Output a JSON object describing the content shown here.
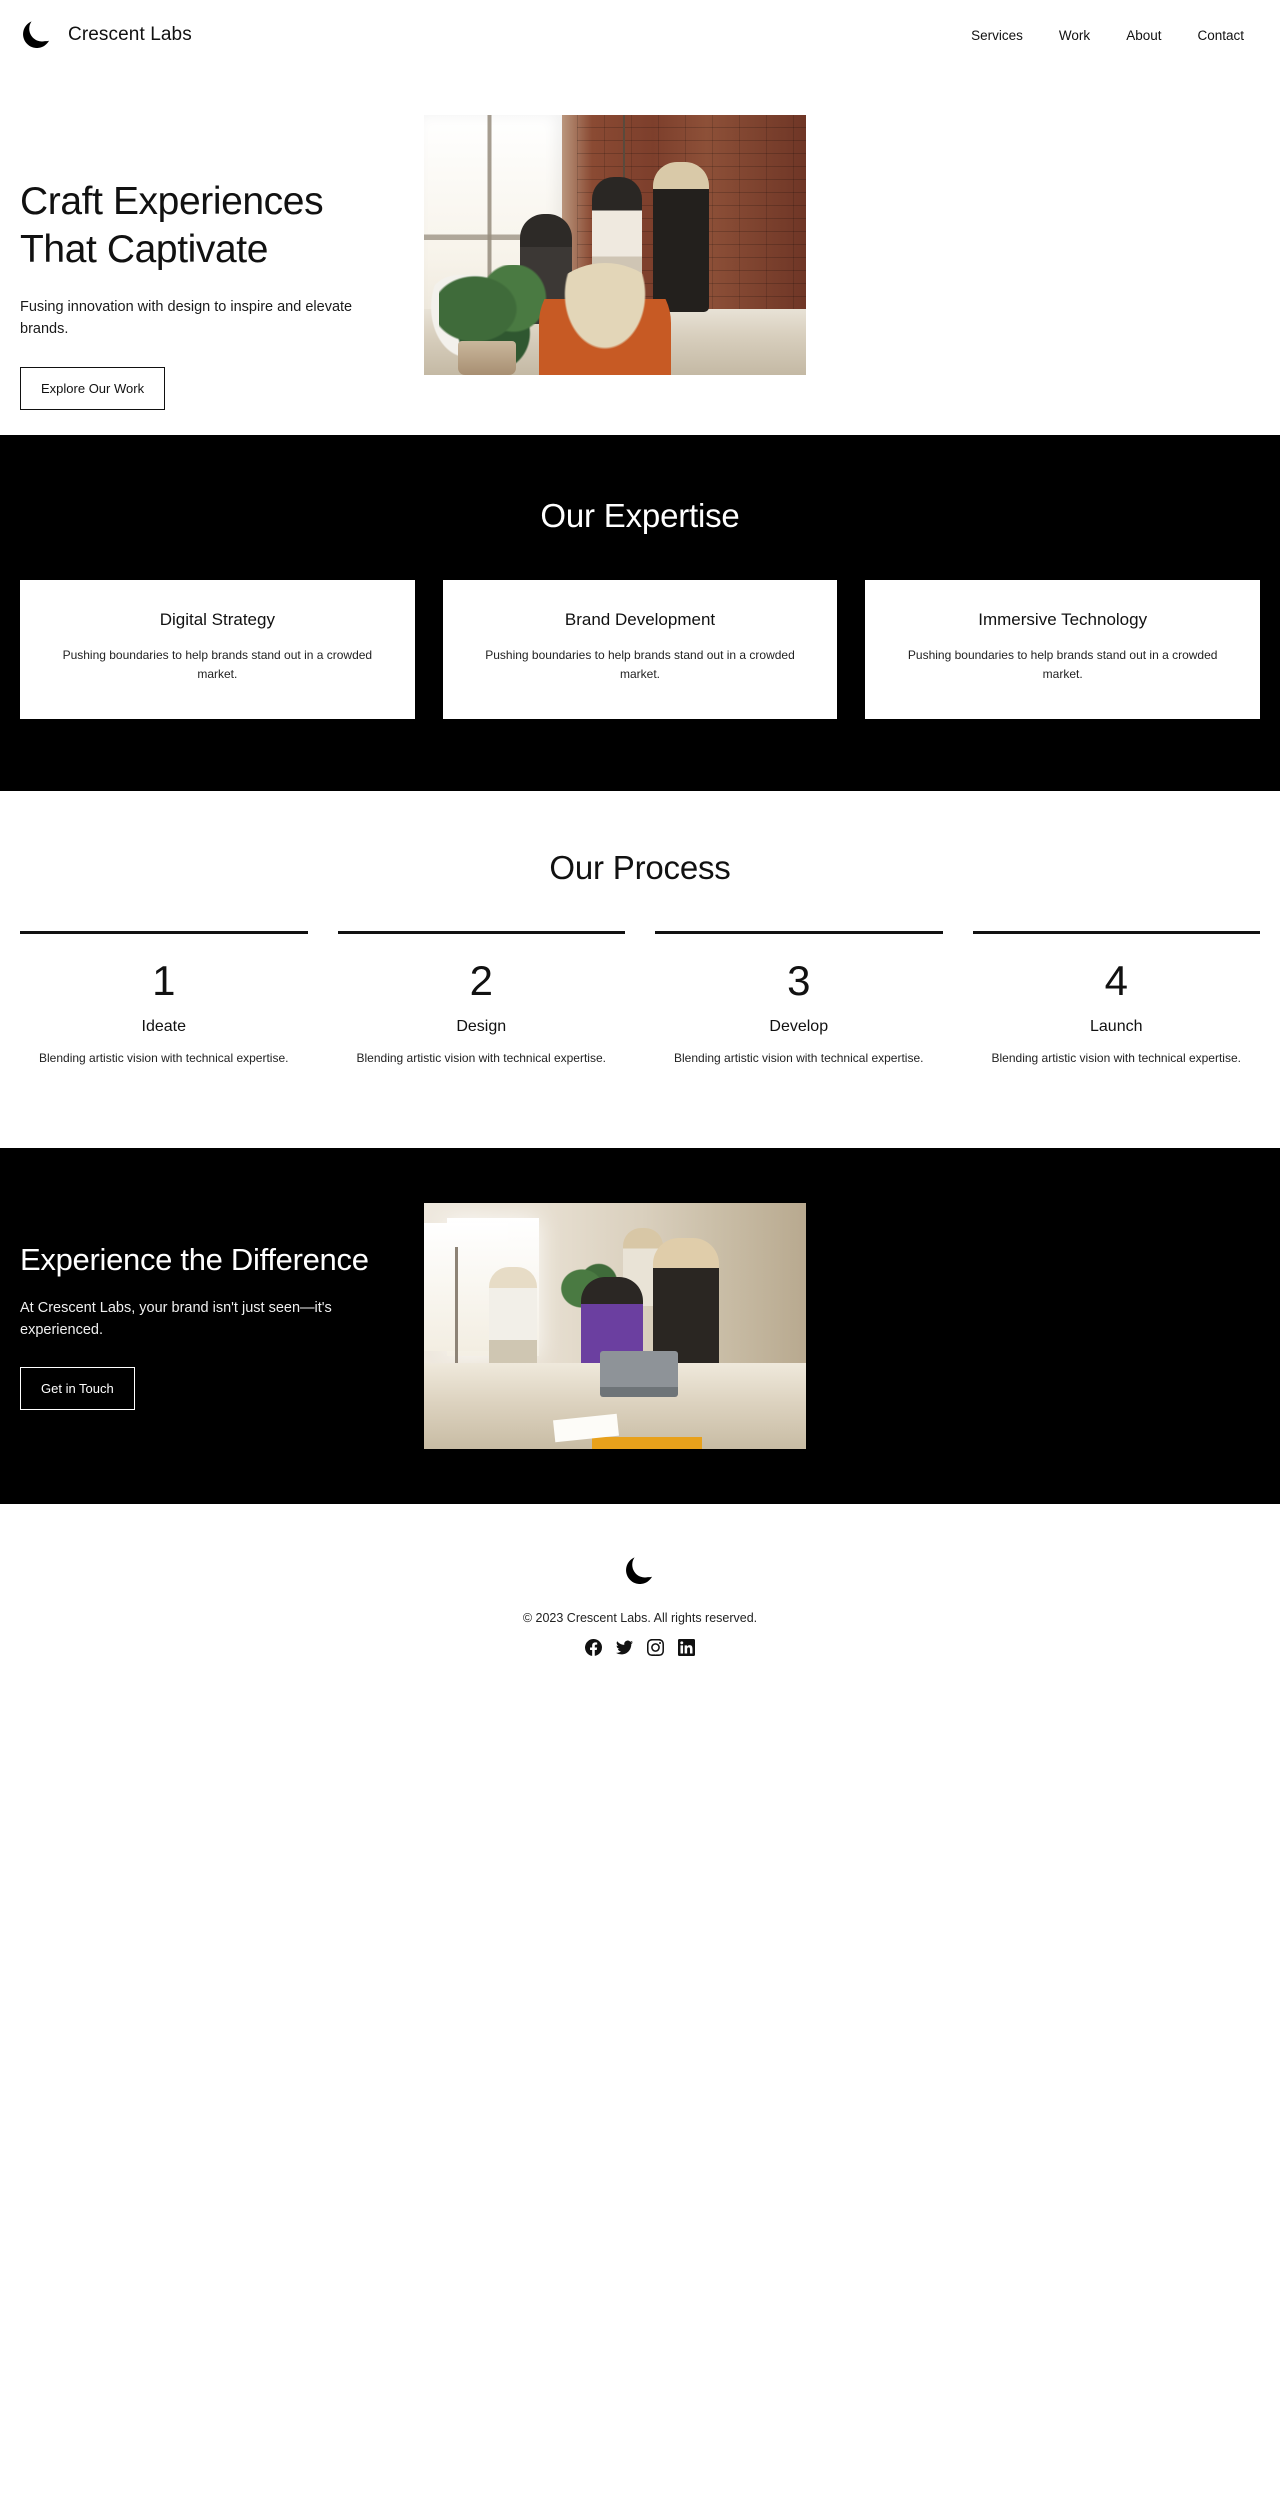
{
  "header": {
    "logo_icon": "crescent-moon-icon",
    "brand_name": "Crescent Labs",
    "nav": [
      {
        "label": "Services"
      },
      {
        "label": "Work"
      },
      {
        "label": "About"
      },
      {
        "label": "Contact"
      }
    ]
  },
  "hero": {
    "title": "Craft Experiences\nThat Captivate",
    "subtitle": "Fusing innovation with design to inspire and elevate brands.",
    "cta_label": "Explore Our Work",
    "image_alt": "Team collaborating in a brick-walled studio office"
  },
  "expertise": {
    "title": "Our Expertise",
    "cards": [
      {
        "title": "Digital Strategy",
        "body": "Pushing boundaries to help brands stand out in a crowded market."
      },
      {
        "title": "Brand Development",
        "body": "Pushing boundaries to help brands stand out in a crowded market."
      },
      {
        "title": "Immersive Technology",
        "body": "Pushing boundaries to help brands stand out in a crowded market."
      }
    ]
  },
  "process": {
    "title": "Our Process",
    "steps": [
      {
        "number": "1",
        "label": "Ideate",
        "body": "Blending artistic vision with technical expertise."
      },
      {
        "number": "2",
        "label": "Design",
        "body": "Blending artistic vision with technical expertise."
      },
      {
        "number": "3",
        "label": "Develop",
        "body": "Blending artistic vision with technical expertise."
      },
      {
        "number": "4",
        "label": "Launch",
        "body": "Blending artistic vision with technical expertise."
      }
    ]
  },
  "cta": {
    "title": "Experience the Difference",
    "subtitle": "At Crescent Labs, your brand isn't just seen—it's experienced.",
    "button_label": "Get in Touch",
    "image_alt": "Team reviewing work around a laptop in a bright studio"
  },
  "footer": {
    "logo_icon": "crescent-moon-icon",
    "copyright": "© 2023 Crescent Labs. All rights reserved.",
    "social": [
      {
        "name": "facebook-icon"
      },
      {
        "name": "twitter-icon"
      },
      {
        "name": "instagram-icon"
      },
      {
        "name": "linkedin-icon"
      }
    ]
  },
  "theme": {
    "background": "#ffffff",
    "dark_section": "#000000",
    "text": "#111111",
    "light_text": "#ffffff"
  }
}
